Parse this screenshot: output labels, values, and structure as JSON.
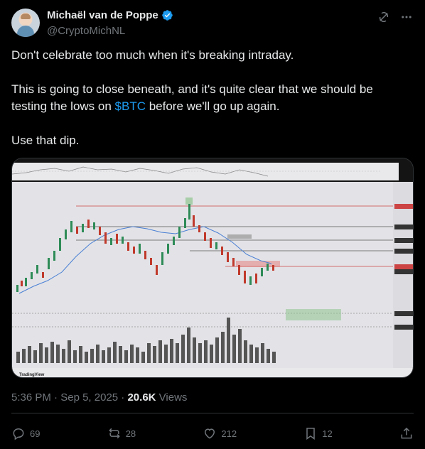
{
  "author": {
    "display_name": "Michaël van de Poppe",
    "handle": "@CryptoMichNL"
  },
  "tweet": {
    "line1": "Don't celebrate too much when it's breaking intraday.",
    "line2_before": "This is going to close beneath, and it's quite clear that we should be testing the lows on ",
    "cashtag": "$BTC",
    "line2_after": " before we'll go up again.",
    "line3": "Use that dip."
  },
  "meta": {
    "time": "5:36 PM",
    "sep1": " · ",
    "date": "Sep 5, 2025",
    "sep2": " · ",
    "views": "20.6K",
    "views_label": " Views"
  },
  "actions": {
    "replies": "69",
    "reposts": "28",
    "likes": "212",
    "bookmarks": "12"
  },
  "chart": {
    "brand": "TradingView",
    "icons": [
      "grok-icon",
      "more-icon"
    ]
  },
  "colors": {
    "accent": "#1d9bf0",
    "muted": "#71767b",
    "text": "#e7e9ea"
  }
}
